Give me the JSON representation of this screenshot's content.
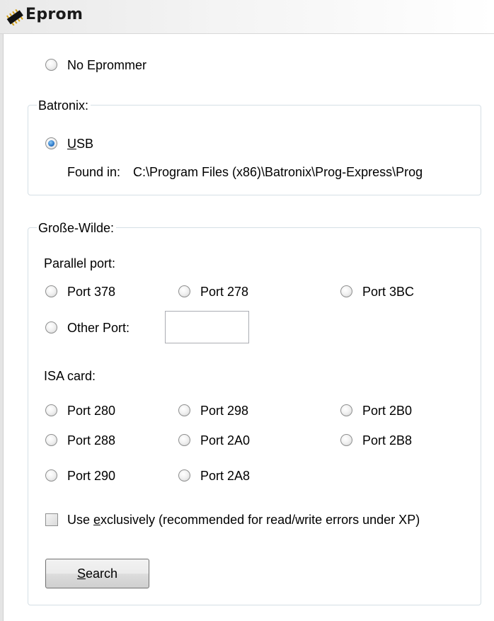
{
  "header": {
    "title": "Eprom",
    "icon": "chip-icon"
  },
  "no_eprommer": {
    "label": "No Eprommer",
    "checked": false
  },
  "batronix": {
    "legend": "Batronix:",
    "usb": {
      "label_access": "U",
      "label_rest": "SB",
      "checked": true
    },
    "found_in_label": "Found in:",
    "found_in_path": "C:\\Program Files (x86)\\Batronix\\Prog-Express\\Prog"
  },
  "grosse_wilde": {
    "legend": "Große-Wilde:",
    "parallel": {
      "label": "Parallel port:",
      "ports": [
        "Port 378",
        "Port 278",
        "Port 3BC"
      ],
      "other_label": "Other Port:",
      "other_value": ""
    },
    "isa": {
      "label": "ISA card:",
      "ports": [
        "Port 280",
        "Port 298",
        "Port 2B0",
        "Port 288",
        "Port 2A0",
        "Port 2B8",
        "Port 290",
        "Port 2A8"
      ]
    },
    "exclusive": {
      "label_pre": "Use ",
      "label_access": "e",
      "label_post": "xclusively (recommended for read/write errors under XP)",
      "checked": false
    },
    "search_button": {
      "label_access": "S",
      "label_rest": "earch"
    }
  }
}
